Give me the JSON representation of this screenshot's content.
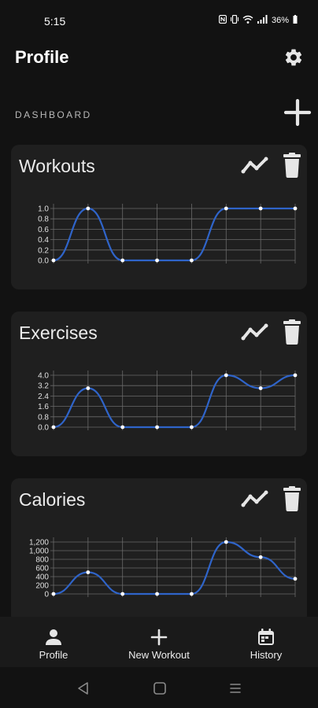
{
  "status_bar": {
    "time": "5:15",
    "icons": [
      "nfc-icon",
      "vibrate-icon",
      "wifi-icon",
      "signal-icon",
      "battery-icon"
    ],
    "battery_text": "36%"
  },
  "header": {
    "title": "Profile",
    "settings_icon": "gear-icon"
  },
  "dashboard": {
    "section_label": "DASHBOARD",
    "add_icon": "plus-icon",
    "accent_color": "#2f64c9",
    "cards": [
      {
        "title": "Workouts",
        "trend_icon": "trend-line-icon",
        "delete_icon": "trash-icon",
        "chart_data": {
          "type": "line",
          "y_ticks": [
            "1.0",
            "0.8",
            "0.6",
            "0.4",
            "0.2",
            "0.0"
          ],
          "ylim": [
            0,
            1
          ],
          "values": [
            0,
            1,
            0,
            0,
            0,
            1,
            1,
            1
          ],
          "grid": true
        }
      },
      {
        "title": "Exercises",
        "trend_icon": "trend-line-icon",
        "delete_icon": "trash-icon",
        "chart_data": {
          "type": "line",
          "y_ticks": [
            "4.0",
            "3.2",
            "2.4",
            "1.6",
            "0.8",
            "0.0"
          ],
          "ylim": [
            0,
            4
          ],
          "values": [
            0,
            3,
            0,
            0,
            0,
            4,
            3,
            4
          ],
          "grid": true
        }
      },
      {
        "title": "Calories",
        "trend_icon": "trend-line-icon",
        "delete_icon": "trash-icon",
        "chart_data": {
          "type": "line",
          "y_ticks": [
            "1,200",
            "1,000",
            "800",
            "600",
            "400",
            "200",
            "0"
          ],
          "ylim": [
            0,
            1200
          ],
          "values": [
            0,
            500,
            0,
            0,
            0,
            1200,
            850,
            350
          ],
          "grid": true
        }
      }
    ]
  },
  "bottom_nav": {
    "items": [
      {
        "label": "Profile",
        "icon": "person-icon"
      },
      {
        "label": "New Workout",
        "icon": "plus-icon"
      },
      {
        "label": "History",
        "icon": "calendar-icon"
      }
    ]
  },
  "system_nav": {
    "back_icon": "back-triangle-icon",
    "home_icon": "home-square-icon",
    "recents_icon": "recents-lines-icon"
  }
}
